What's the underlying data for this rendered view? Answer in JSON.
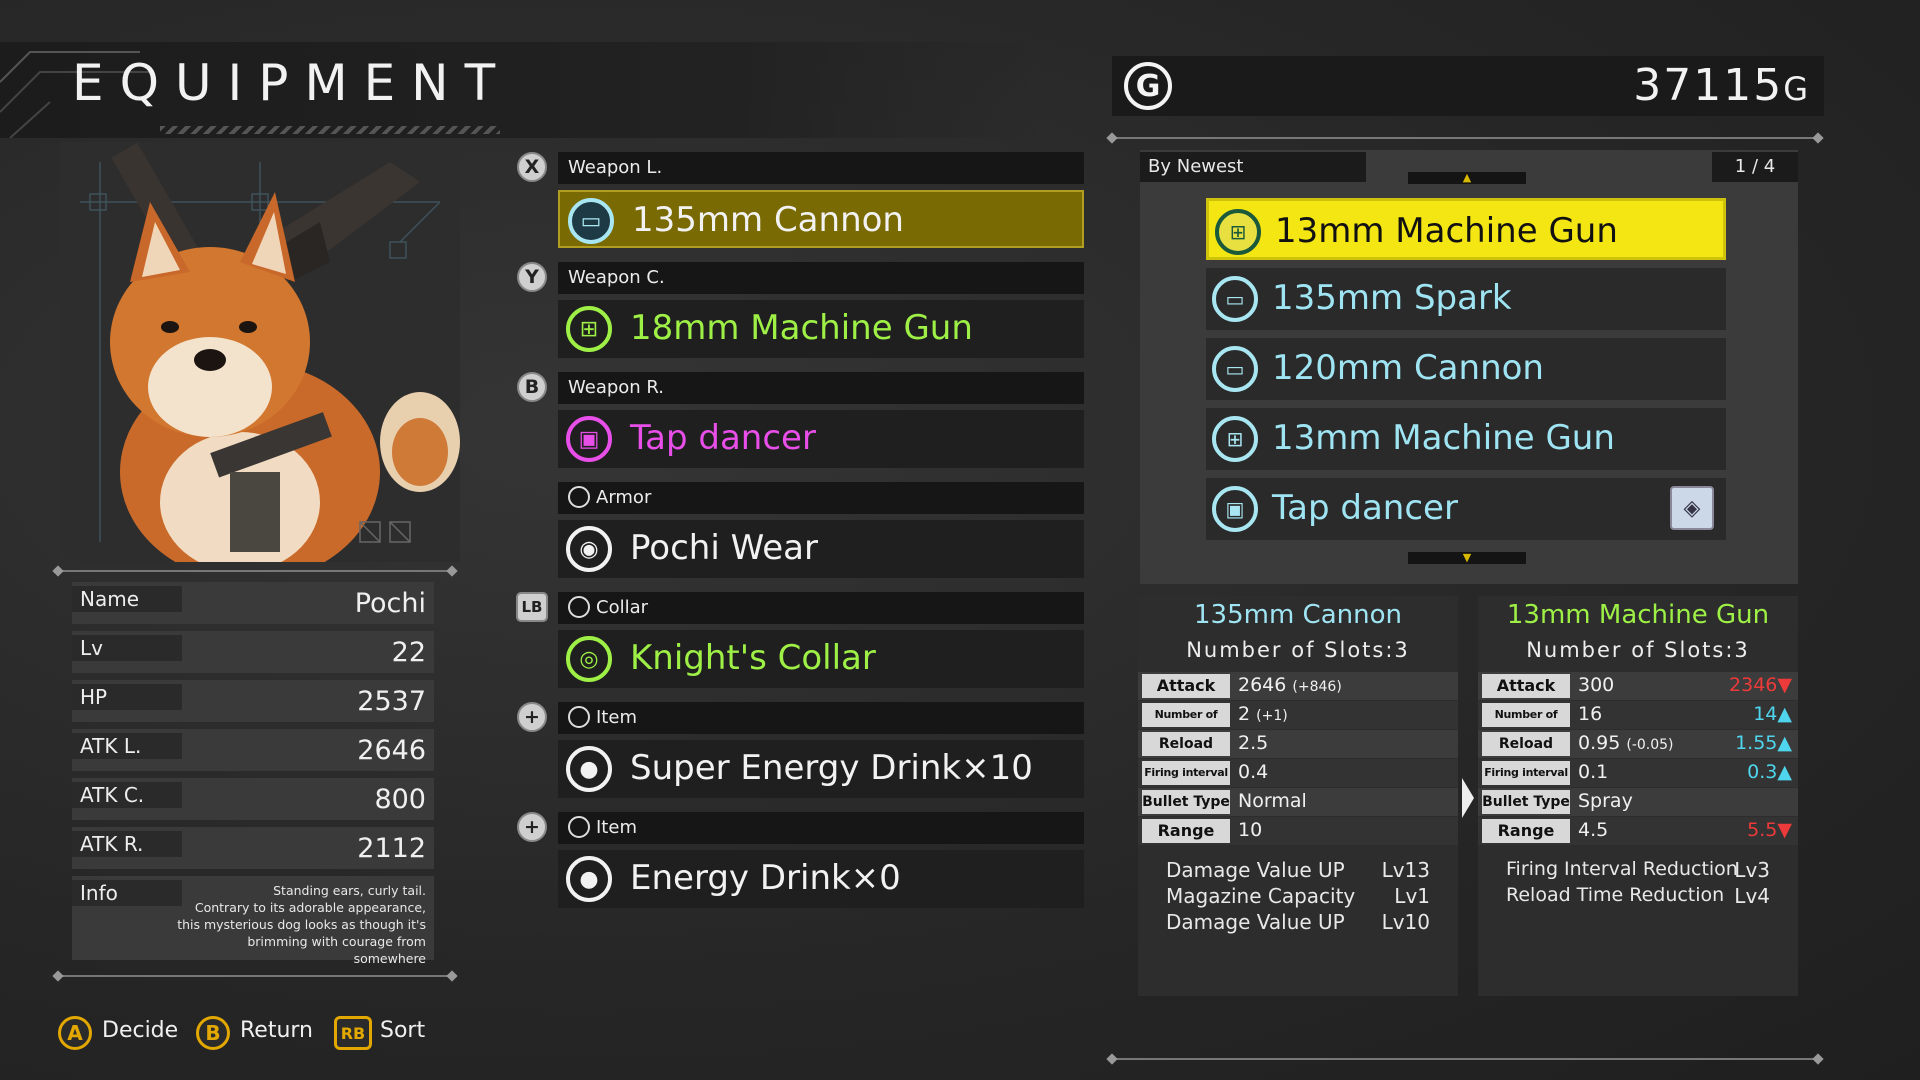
{
  "header": {
    "title": "EQUIPMENT"
  },
  "gold": {
    "icon": "G",
    "amount": "37115",
    "unit": "G"
  },
  "status": [
    {
      "label": "Name",
      "value": "Pochi"
    },
    {
      "label": "Lv",
      "value": "22"
    },
    {
      "label": "HP",
      "value": "2537"
    },
    {
      "label": "ATK L.",
      "value": "2646"
    },
    {
      "label": "ATK C.",
      "value": "800"
    },
    {
      "label": "ATK R.",
      "value": "2112"
    }
  ],
  "info": {
    "label": "Info",
    "text_lines": [
      "Standing ears, curly tail.",
      "Contrary to its adorable appearance,",
      "this mysterious dog looks as though it's",
      "brimming with courage from somewhere"
    ]
  },
  "slots": [
    {
      "button": "X",
      "header": "Weapon L.",
      "name": "135mm Cannon",
      "color": "#a8e6f2",
      "icon": "cannon-icon",
      "selected": true
    },
    {
      "button": "Y",
      "header": "Weapon C.",
      "name": "18mm Machine Gun",
      "color": "#9ef046",
      "icon": "machine-gun-icon"
    },
    {
      "button": "B",
      "header": "Weapon R.",
      "name": "Tap dancer",
      "color": "#e84ee8",
      "icon": "tap-dancer-icon"
    },
    {
      "button": "",
      "header": "Armor",
      "name": "Pochi Wear",
      "color": "#f2f2f2",
      "icon": "armor-icon"
    },
    {
      "button": "LB",
      "header": "Collar",
      "name": "Knight's Collar",
      "color": "#9ef046",
      "icon": "collar-icon"
    },
    {
      "button": "+",
      "header": "Item",
      "name": "Super Energy Drink×10",
      "color": "#f2f2f2",
      "icon": "item-icon"
    },
    {
      "button": "+",
      "header": "Item",
      "name": "Energy Drink×0",
      "color": "#f2f2f2",
      "icon": "item-icon"
    }
  ],
  "list": {
    "sort": "By Newest",
    "page": "1 / 4",
    "items": [
      {
        "name": "13mm Machine Gun",
        "icon": "machine-gun-icon",
        "selected": true
      },
      {
        "name": "135mm Spark",
        "icon": "cannon-icon"
      },
      {
        "name": "120mm Cannon",
        "icon": "cannon-icon"
      },
      {
        "name": "13mm Machine Gun",
        "icon": "machine-gun-icon"
      },
      {
        "name": "Tap dancer",
        "icon": "tap-dancer-icon",
        "badge": "wolf-badge-icon"
      }
    ]
  },
  "compare": {
    "current": {
      "name": "135mm Cannon",
      "slots": "Number of Slots:3",
      "rows": [
        {
          "key": "Attack",
          "value": "2646",
          "delta": "(+846)"
        },
        {
          "key": "Number of Bullets",
          "value": "2",
          "delta": "(+1)"
        },
        {
          "key": "Reload Time",
          "value": "2.5",
          "delta": ""
        },
        {
          "key": "Firing interval",
          "value": "0.4",
          "delta": ""
        },
        {
          "key": "Bullet Type",
          "value": "Normal",
          "delta": ""
        },
        {
          "key": "Range",
          "value": "10",
          "delta": ""
        }
      ],
      "skills": [
        {
          "name": "Damage Value UP",
          "level": "Lv13"
        },
        {
          "name": "Magazine Capacity",
          "level": "Lv1"
        },
        {
          "name": "Damage Value UP",
          "level": "Lv10"
        }
      ]
    },
    "candidate": {
      "name": "13mm Machine Gun",
      "slots": "Number of Slots:3",
      "rows": [
        {
          "key": "Attack",
          "value": "300",
          "delta": "",
          "compare": "2346",
          "dir": "down"
        },
        {
          "key": "Number of Bullets",
          "value": "16",
          "delta": "",
          "compare": "14",
          "dir": "up"
        },
        {
          "key": "Reload Time",
          "value": "0.95",
          "delta": "(-0.05)",
          "compare": "1.55",
          "dir": "up"
        },
        {
          "key": "Firing interval",
          "value": "0.1",
          "delta": "",
          "compare": "0.3",
          "dir": "up"
        },
        {
          "key": "Bullet Type",
          "value": "Spray",
          "delta": "",
          "compare": "",
          "dir": ""
        },
        {
          "key": "Range",
          "value": "4.5",
          "delta": "",
          "compare": "5.5",
          "dir": "down"
        }
      ],
      "skills": [
        {
          "name": "Firing Interval Reduction",
          "level": "Lv3"
        },
        {
          "name": "Reload Time Reduction",
          "level": "Lv4"
        }
      ]
    }
  },
  "footer": [
    {
      "button": "A",
      "label": "Decide"
    },
    {
      "button": "B",
      "label": "Return"
    },
    {
      "button": "RB",
      "label": "Sort"
    }
  ],
  "colors": {
    "selected_gold": "#f4e613",
    "accent_yellow": "#e3a800",
    "cyan": "#a8e6f2",
    "green": "#9ef046",
    "magenta": "#e84ee8"
  }
}
